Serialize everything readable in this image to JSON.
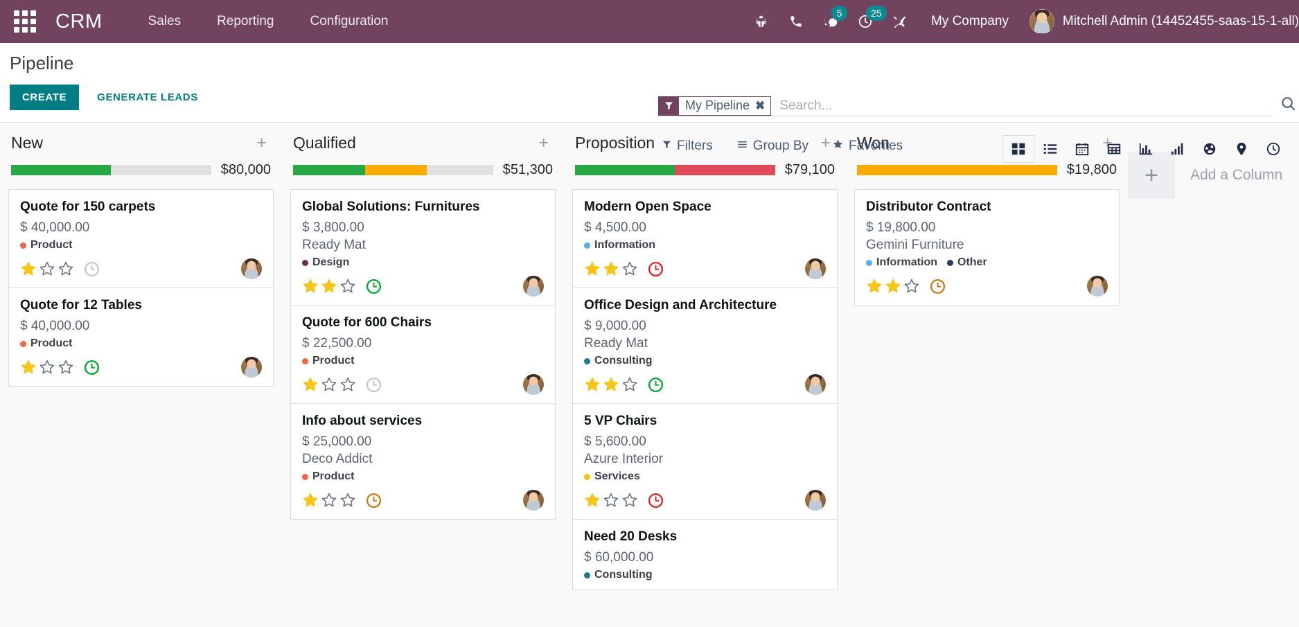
{
  "navbar": {
    "apps_icon": "apps-grid-icon",
    "brand": "CRM",
    "menus": [
      {
        "label": "Sales"
      },
      {
        "label": "Reporting"
      },
      {
        "label": "Configuration"
      }
    ],
    "icons": [
      {
        "name": "bug-icon",
        "badge": null
      },
      {
        "name": "phone-icon",
        "badge": null
      },
      {
        "name": "messages-icon",
        "badge": "5"
      },
      {
        "name": "activities-clock-icon",
        "badge": "25"
      },
      {
        "name": "tools-icon",
        "badge": null
      }
    ],
    "company": "My Company",
    "user": "Mitchell Admin (14452455-saas-15-1-all)"
  },
  "control_panel": {
    "title": "Pipeline",
    "create_label": "CREATE",
    "generate_leads_label": "GENERATE LEADS",
    "search": {
      "facet_label": "My Pipeline",
      "facet_remove": "✖",
      "placeholder": "Search..."
    },
    "menus": [
      {
        "label": "Filters",
        "icon": "filter-icon"
      },
      {
        "label": "Group By",
        "icon": "group-by-icon"
      },
      {
        "label": "Favorites",
        "icon": "star-icon"
      }
    ],
    "views": [
      {
        "name": "kanban-view",
        "active": true
      },
      {
        "name": "list-view",
        "active": false
      },
      {
        "name": "calendar-view",
        "active": false
      },
      {
        "name": "pivot-view",
        "active": false
      },
      {
        "name": "graph-view",
        "active": false
      },
      {
        "name": "bar-chart-view",
        "active": false
      },
      {
        "name": "dashboard-view",
        "active": false
      },
      {
        "name": "map-view",
        "active": false
      },
      {
        "name": "activity-view",
        "active": false
      }
    ]
  },
  "kanban": {
    "add_column_label": "Add a Column",
    "columns": [
      {
        "title": "New",
        "amount": "$80,000",
        "progress": [
          {
            "color": "#28a745",
            "pct": 50
          },
          {
            "color": "#e0e0e0",
            "pct": 50
          }
        ],
        "cards": [
          {
            "title": "Quote for 150 carpets",
            "amount": "$ 40,000.00",
            "partner": null,
            "tags": [
              {
                "label": "Product",
                "color": "#f0654a"
              }
            ],
            "stars": 1,
            "activity": "gray"
          },
          {
            "title": "Quote for 12 Tables",
            "amount": "$ 40,000.00",
            "partner": null,
            "tags": [
              {
                "label": "Product",
                "color": "#f0654a"
              }
            ],
            "stars": 1,
            "activity": "green"
          }
        ]
      },
      {
        "title": "Qualified",
        "amount": "$51,300",
        "progress": [
          {
            "color": "#28a745",
            "pct": 36
          },
          {
            "color": "#fdab00",
            "pct": 31
          },
          {
            "color": "#e0e0e0",
            "pct": 33
          }
        ],
        "cards": [
          {
            "title": "Global Solutions: Furnitures",
            "amount": "$ 3,800.00",
            "partner": "Ready Mat",
            "tags": [
              {
                "label": "Design",
                "color": "#6b2f4e"
              }
            ],
            "stars": 2,
            "activity": "green"
          },
          {
            "title": "Quote for 600 Chairs",
            "amount": "$ 22,500.00",
            "partner": null,
            "tags": [
              {
                "label": "Product",
                "color": "#f0654a"
              }
            ],
            "stars": 1,
            "activity": "gray"
          },
          {
            "title": "Info about services",
            "amount": "$ 25,000.00",
            "partner": "Deco Addict",
            "tags": [
              {
                "label": "Product",
                "color": "#f0654a"
              }
            ],
            "stars": 1,
            "activity": "orange"
          }
        ]
      },
      {
        "title": "Proposition",
        "amount": "$79,100",
        "progress": [
          {
            "color": "#28a745",
            "pct": 50
          },
          {
            "color": "#e04a59",
            "pct": 50
          }
        ],
        "cards": [
          {
            "title": "Modern Open Space",
            "amount": "$ 4,500.00",
            "partner": null,
            "tags": [
              {
                "label": "Information",
                "color": "#5ab0e8"
              }
            ],
            "stars": 2,
            "activity": "red"
          },
          {
            "title": "Office Design and Architecture",
            "amount": "$ 9,000.00",
            "partner": "Ready Mat",
            "tags": [
              {
                "label": "Consulting",
                "color": "#1f7a8c"
              }
            ],
            "stars": 2,
            "activity": "green"
          },
          {
            "title": "5 VP Chairs",
            "amount": "$ 5,600.00",
            "partner": "Azure Interior",
            "tags": [
              {
                "label": "Services",
                "color": "#f1c40f"
              }
            ],
            "stars": 1,
            "activity": "red"
          },
          {
            "title": "Need 20 Desks",
            "amount": "$ 60,000.00",
            "partner": null,
            "tags": [
              {
                "label": "Consulting",
                "color": "#1f7a8c"
              }
            ],
            "stars": 0,
            "activity": null
          }
        ]
      },
      {
        "title": "Won",
        "amount": "$19,800",
        "progress": [
          {
            "color": "#fdab00",
            "pct": 100
          }
        ],
        "cards": [
          {
            "title": "Distributor Contract",
            "amount": "$ 19,800.00",
            "partner": "Gemini Furniture",
            "tags": [
              {
                "label": "Information",
                "color": "#5ab0e8"
              },
              {
                "label": "Other",
                "color": "#2b3a67"
              }
            ],
            "stars": 2,
            "activity": "orange"
          }
        ]
      }
    ]
  }
}
